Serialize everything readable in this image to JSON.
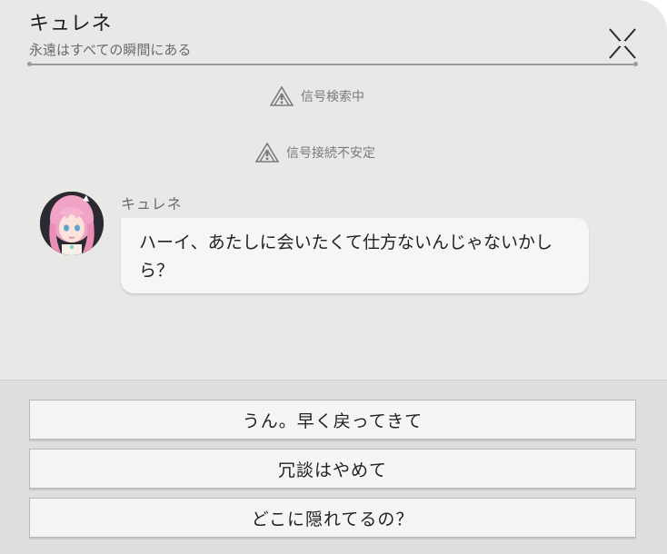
{
  "header": {
    "title": "キュレネ",
    "subtitle": "永遠はすべての瞬間にある"
  },
  "icons": {
    "close": "close-icon",
    "signal_warning": "signal-warning-icon",
    "avatar": "character-avatar"
  },
  "system_messages": [
    {
      "text": "信号検索中"
    },
    {
      "text": "信号接続不安定"
    }
  ],
  "message": {
    "speaker": "キュレネ",
    "text": "ハーイ、あたしに会いたくて仕方ないんじゃないかしら？"
  },
  "choices": [
    {
      "label": "うん。早く戻ってきて"
    },
    {
      "label": "冗談はやめて"
    },
    {
      "label": "どこに隠れてるの？"
    }
  ],
  "colors": {
    "panel_bg": "#e8e8e7",
    "bubble_bg": "#f6f6f5",
    "choice_bg": "#f5f5f4",
    "text_dark": "#222222",
    "text_muted": "#7a7a7a"
  }
}
